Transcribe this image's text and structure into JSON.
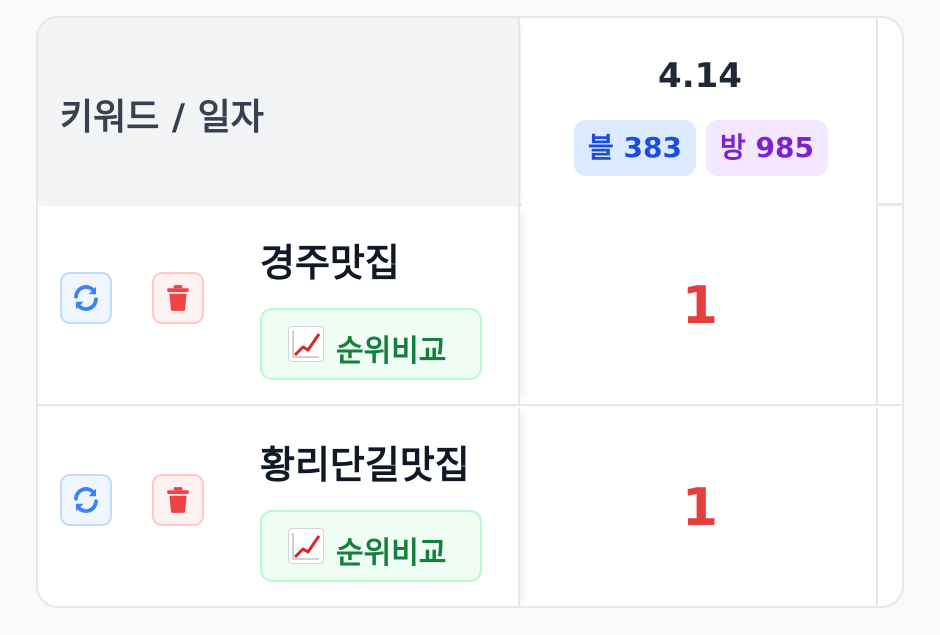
{
  "header": {
    "keyword_date_label": "키워드 / 일자",
    "date": "4.14",
    "badge_blog": "블 383",
    "badge_place": "방 985"
  },
  "rows": [
    {
      "keyword": "경주맛집",
      "compare_label": "순위비교",
      "rank": "1"
    },
    {
      "keyword": "황리단길맛집",
      "compare_label": "순위비교",
      "rank": "1"
    }
  ],
  "icons": {
    "refresh": "refresh-icon",
    "delete": "trash-icon",
    "compare": "chart-increasing-icon"
  },
  "colors": {
    "rank": "#e53e3e",
    "badge_blog": "#1d4ed8",
    "badge_place": "#7e22ce",
    "compare": "#15803d"
  }
}
